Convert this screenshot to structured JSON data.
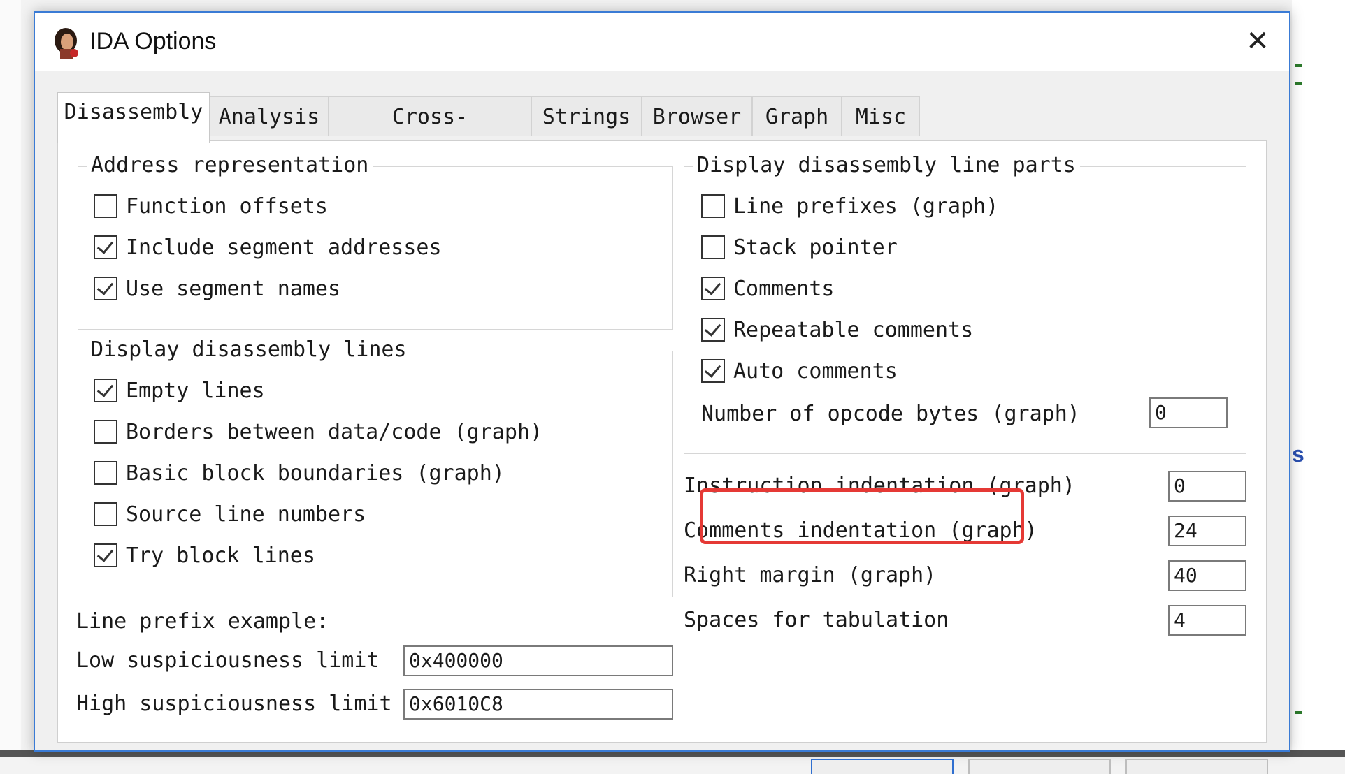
{
  "window": {
    "title": "IDA Options",
    "close_symbol": "✕"
  },
  "tabs": [
    {
      "label": "Disassembly",
      "active": true
    },
    {
      "label": "Analysis"
    },
    {
      "label": "Cross-references"
    },
    {
      "label": "Strings"
    },
    {
      "label": "Browser"
    },
    {
      "label": "Graph"
    },
    {
      "label": "Misc"
    }
  ],
  "address_representation": {
    "legend": "Address representation",
    "options": [
      {
        "label": "Function offsets",
        "checked": false
      },
      {
        "label": "Include segment addresses",
        "checked": true
      },
      {
        "label": "Use segment names",
        "checked": true
      }
    ]
  },
  "display_lines": {
    "legend": "Display disassembly lines",
    "options": [
      {
        "label": "Empty lines",
        "checked": true
      },
      {
        "label": "Borders between data/code (graph)",
        "checked": false
      },
      {
        "label": "Basic block boundaries (graph)",
        "checked": false
      },
      {
        "label": "Source line numbers",
        "checked": false
      },
      {
        "label": "Try block lines",
        "checked": true
      }
    ]
  },
  "line_prefix": {
    "label": "Line prefix example:",
    "low_label": "Low suspiciousness limit",
    "low_value": "0x400000",
    "high_label": "High suspiciousness limit",
    "high_value": "0x6010C8"
  },
  "line_parts": {
    "legend": "Display disassembly line parts",
    "options": [
      {
        "label": "Line prefixes (graph)",
        "checked": false
      },
      {
        "label": "Stack pointer",
        "checked": false
      },
      {
        "label": "Comments",
        "checked": true
      },
      {
        "label": "Repeatable comments",
        "checked": true
      },
      {
        "label": "Auto comments",
        "checked": true
      }
    ],
    "opcode_label": "Number of opcode bytes (graph)",
    "opcode_value": "0"
  },
  "settings": [
    {
      "label": "Instruction indentation (graph)",
      "value": "0"
    },
    {
      "label": "Comments indentation (graph)",
      "value": "24"
    },
    {
      "label": "Right margin (graph)",
      "value": "40"
    },
    {
      "label": "Spaces for tabulation",
      "value": "4"
    }
  ],
  "colors": {
    "highlight": "#e53935",
    "accent": "#3a7bd5"
  }
}
